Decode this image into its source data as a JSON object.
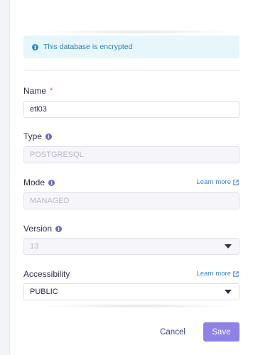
{
  "banner": {
    "text": "This database is encrypted",
    "icon": "info-icon"
  },
  "form": {
    "name": {
      "label": "Name",
      "required_mark": "*",
      "value": "etl03"
    },
    "type": {
      "label": "Type",
      "value": "POSTGRESQL",
      "icon": "help-icon"
    },
    "mode": {
      "label": "Mode",
      "value": "MANAGED",
      "icon": "help-icon",
      "learn_more": "Learn more"
    },
    "version": {
      "label": "Version",
      "value": "13",
      "icon": "help-icon"
    },
    "accessibility": {
      "label": "Accessibility",
      "value": "PUBLIC",
      "learn_more": "Learn more"
    }
  },
  "actions": {
    "cancel_label": "Cancel",
    "save_label": "Save"
  },
  "colors": {
    "accent": "#8f82e6",
    "info_bg": "#e6f6fb",
    "info_text": "#2c7fa8",
    "link": "#3d86c6",
    "required": "#e05252"
  }
}
